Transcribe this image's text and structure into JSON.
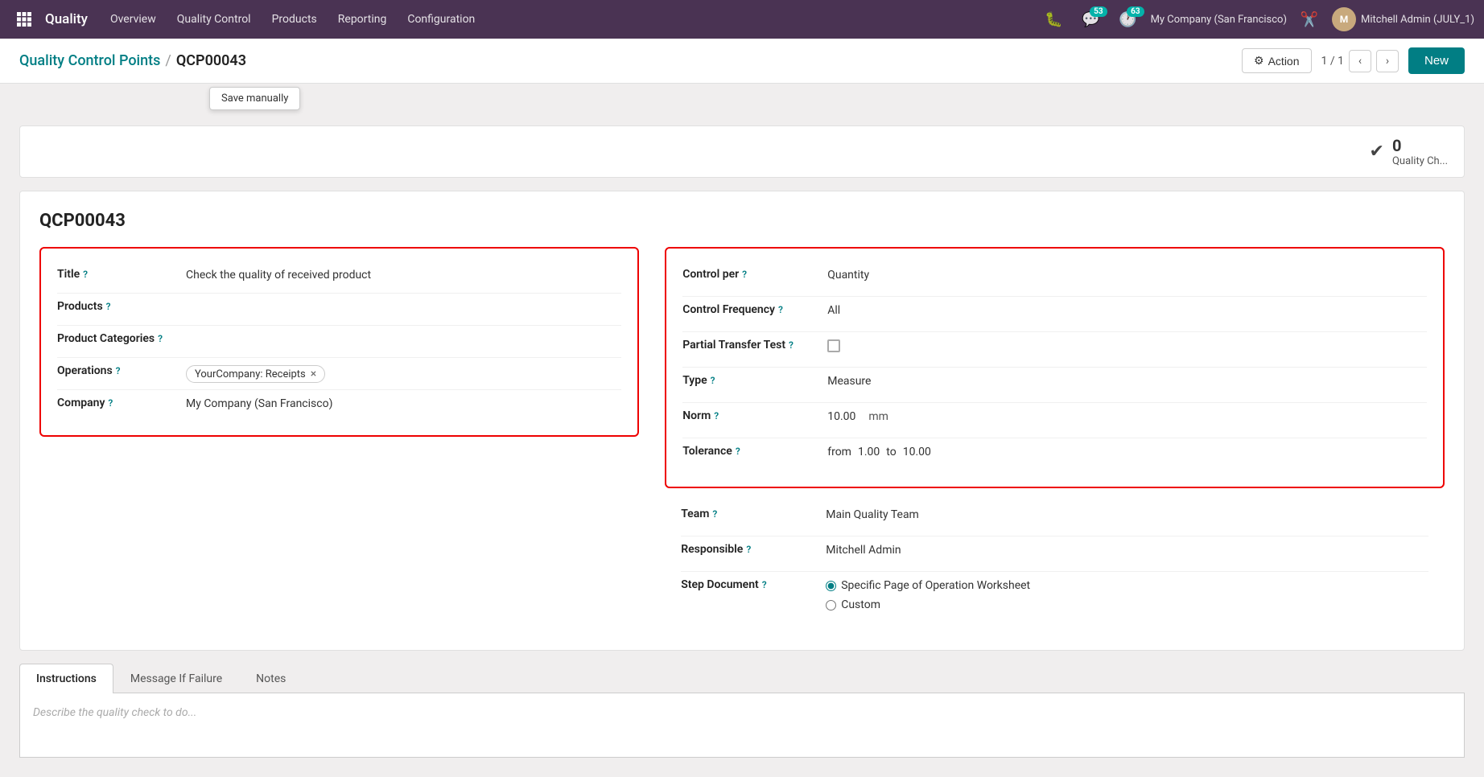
{
  "topnav": {
    "brand": "Quality",
    "menu": [
      {
        "label": "Overview"
      },
      {
        "label": "Quality Control"
      },
      {
        "label": "Products"
      },
      {
        "label": "Reporting"
      },
      {
        "label": "Configuration"
      }
    ],
    "chat_badge": "53",
    "clock_badge": "63",
    "company": "My Company (San Francisco)",
    "user": "Mitchell Admin (JULY_1)"
  },
  "breadcrumb": {
    "parent": "Quality Control Points",
    "current": "QCP00043"
  },
  "toolbar": {
    "action_label": "Action",
    "page_info": "1 / 1",
    "new_label": "New",
    "save_manually_label": "Save manually"
  },
  "stat": {
    "count": "0",
    "label": "Quality Ch..."
  },
  "form": {
    "record_id": "QCP00043",
    "left": {
      "title_label": "Title",
      "title_help": "?",
      "title_value": "Check the quality of received product",
      "products_label": "Products",
      "products_help": "?",
      "products_value": "",
      "product_categories_label": "Product Categories",
      "product_categories_help": "?",
      "product_categories_value": "",
      "operations_label": "Operations",
      "operations_help": "?",
      "operations_tag": "YourCompany: Receipts",
      "company_label": "Company",
      "company_help": "?",
      "company_value": "My Company (San Francisco)"
    },
    "right": {
      "control_per_label": "Control per",
      "control_per_help": "?",
      "control_per_value": "Quantity",
      "control_frequency_label": "Control Frequency",
      "control_frequency_help": "?",
      "control_frequency_value": "All",
      "partial_transfer_label": "Partial Transfer Test",
      "partial_transfer_help": "?",
      "type_label": "Type",
      "type_help": "?",
      "type_value": "Measure",
      "norm_label": "Norm",
      "norm_help": "?",
      "norm_value": "10.00",
      "norm_unit": "mm",
      "tolerance_label": "Tolerance",
      "tolerance_help": "?",
      "tolerance_from_label": "from",
      "tolerance_from_value": "1.00",
      "tolerance_to_label": "to",
      "tolerance_to_value": "10.00",
      "team_label": "Team",
      "team_help": "?",
      "team_value": "Main Quality Team",
      "responsible_label": "Responsible",
      "responsible_help": "?",
      "responsible_value": "Mitchell Admin",
      "step_doc_label": "Step Document",
      "step_doc_help": "?",
      "step_doc_opt1": "Specific Page of Operation Worksheet",
      "step_doc_opt2": "Custom"
    }
  },
  "tabs": {
    "items": [
      {
        "label": "Instructions",
        "active": true
      },
      {
        "label": "Message If Failure",
        "active": false
      },
      {
        "label": "Notes",
        "active": false
      }
    ],
    "placeholder": "Describe the quality check to do..."
  }
}
